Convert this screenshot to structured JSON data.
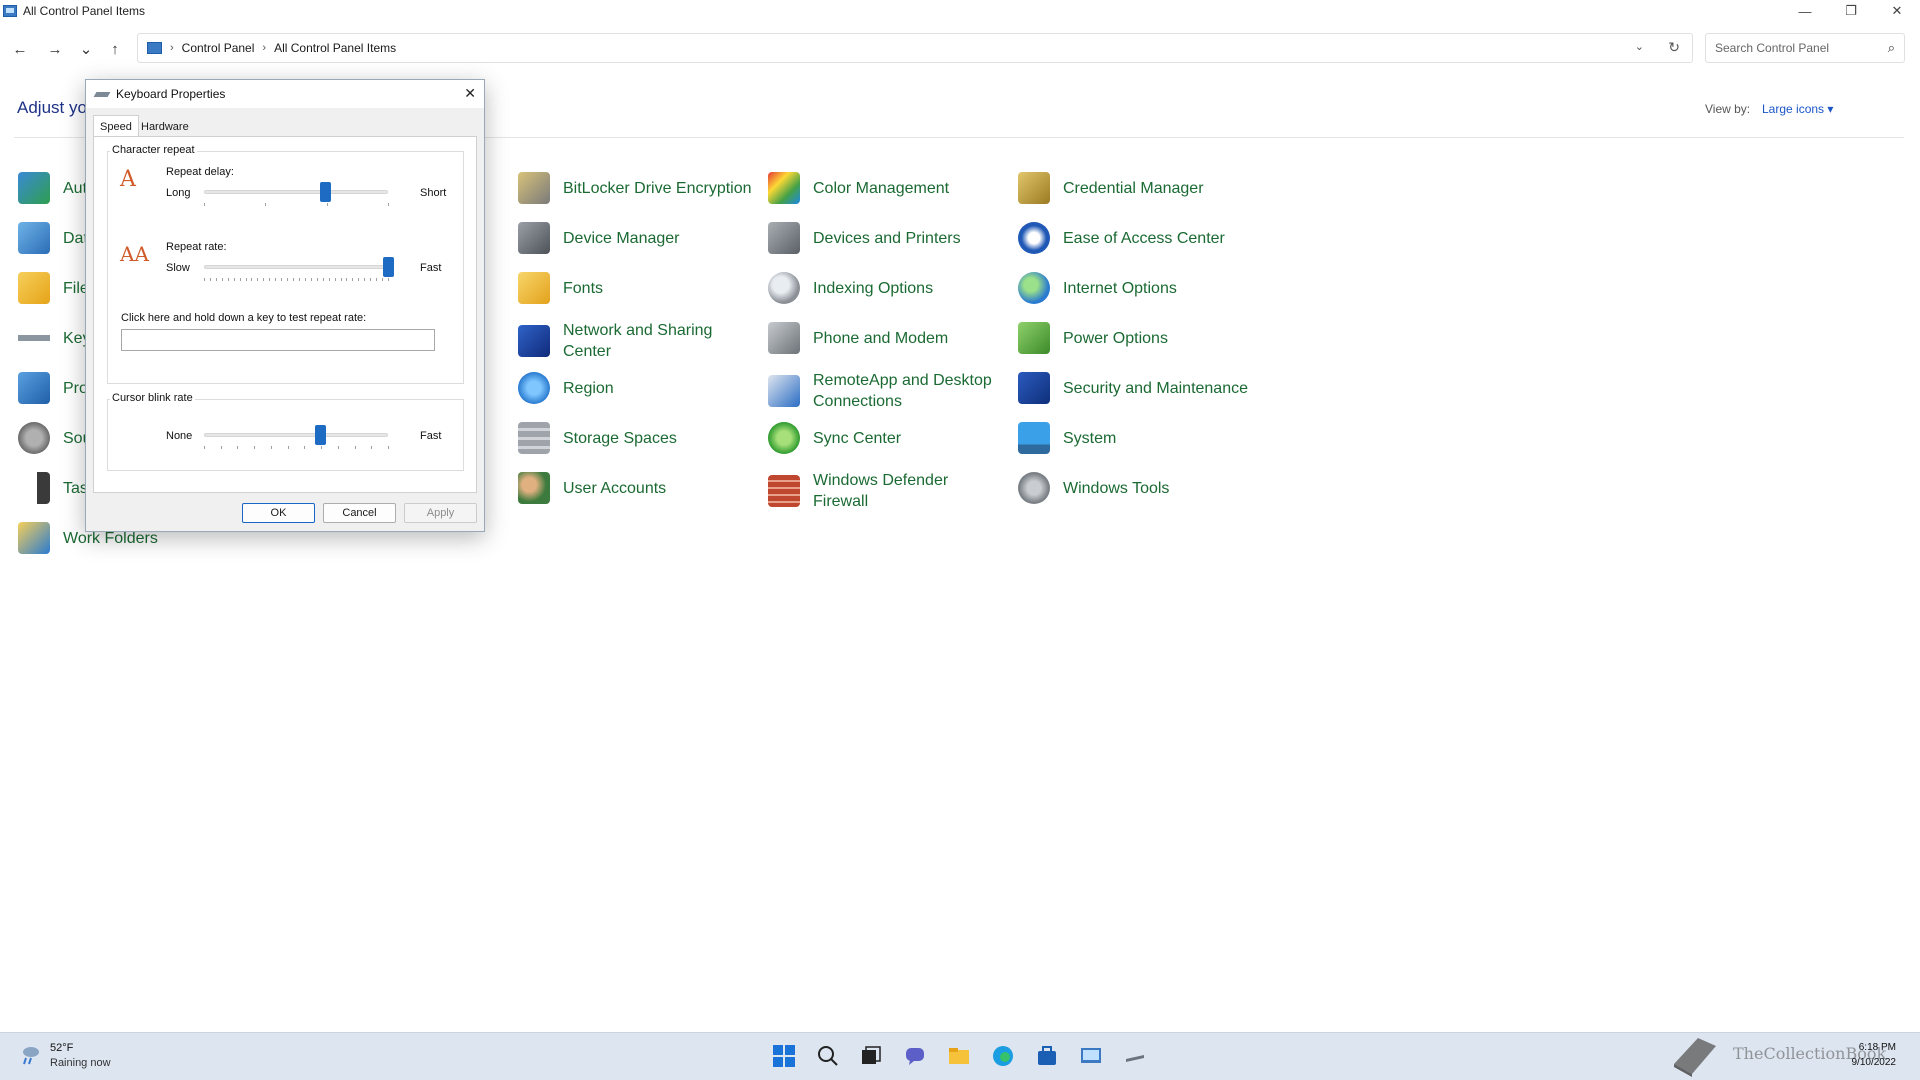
{
  "window": {
    "title": "All Control Panel Items",
    "minimize_glyph": "—",
    "restore_glyph": "❐",
    "close_glyph": "✕"
  },
  "nav": {
    "back_glyph": "←",
    "forward_glyph": "→",
    "recent_glyph": "⌄",
    "up_glyph": "↑"
  },
  "address": {
    "crumbs": [
      "Control Panel",
      "All Control Panel Items"
    ],
    "sep_glyph": "›",
    "dropdown_glyph": "⌄",
    "refresh_glyph": "↻"
  },
  "search": {
    "placeholder": "Search Control Panel",
    "glyph": "⌕"
  },
  "main": {
    "heading_visible": "Adjust yo",
    "view_by_label": "View by:",
    "view_by_value": "Large icons ▾"
  },
  "items_left": [
    {
      "label": "Aut",
      "icon": "autoplay-icon"
    },
    {
      "label": "Dat",
      "icon": "date-time-icon"
    },
    {
      "label": "File",
      "icon": "file-explorer-options-icon"
    },
    {
      "label": "Key",
      "icon": "keyboard-icon"
    },
    {
      "label": "Pro",
      "icon": "programs-icon"
    },
    {
      "label": "Sou",
      "icon": "sound-icon"
    },
    {
      "label": "Tasl",
      "icon": "taskbar-icon"
    },
    {
      "label": "Work Folders",
      "icon": "work-folders-icon"
    }
  ],
  "items_col2": [
    {
      "label": "BitLocker Drive Encryption",
      "icon": "bitlocker-icon"
    },
    {
      "label": "Device Manager",
      "icon": "device-manager-icon"
    },
    {
      "label": "Fonts",
      "icon": "fonts-icon"
    },
    {
      "label": "Network and Sharing Center",
      "icon": "network-icon"
    },
    {
      "label": "Region",
      "icon": "region-icon"
    },
    {
      "label": "Storage Spaces",
      "icon": "storage-spaces-icon"
    },
    {
      "label": "User Accounts",
      "icon": "user-accounts-icon"
    }
  ],
  "items_col3": [
    {
      "label": "Color Management",
      "icon": "color-management-icon"
    },
    {
      "label": "Devices and Printers",
      "icon": "devices-printers-icon"
    },
    {
      "label": "Indexing Options",
      "icon": "indexing-icon"
    },
    {
      "label": "Phone and Modem",
      "icon": "phone-modem-icon"
    },
    {
      "label": "RemoteApp and Desktop Connections",
      "icon": "remoteapp-icon"
    },
    {
      "label": "Sync Center",
      "icon": "sync-center-icon"
    },
    {
      "label": "Windows Defender Firewall",
      "icon": "firewall-icon"
    }
  ],
  "items_col4": [
    {
      "label": "Credential Manager",
      "icon": "credential-manager-icon"
    },
    {
      "label": "Ease of Access Center",
      "icon": "ease-of-access-icon"
    },
    {
      "label": "Internet Options",
      "icon": "internet-options-icon"
    },
    {
      "label": "Power Options",
      "icon": "power-options-icon"
    },
    {
      "label": "Security and Maintenance",
      "icon": "security-maintenance-icon"
    },
    {
      "label": "System",
      "icon": "system-icon"
    },
    {
      "label": "Windows Tools",
      "icon": "windows-tools-icon"
    }
  ],
  "dialog": {
    "title": "Keyboard Properties",
    "close_glyph": "✕",
    "tabs": [
      "Speed",
      "Hardware"
    ],
    "character_repeat": {
      "group_title": "Character repeat",
      "repeat_delay_label": "Repeat delay:",
      "delay_min_label": "Long",
      "delay_max_label": "Short",
      "delay_value_fraction": 0.66,
      "repeat_rate_label": "Repeat rate:",
      "rate_min_label": "Slow",
      "rate_max_label": "Fast",
      "rate_value_fraction": 1.0,
      "test_label": "Click here and hold down a key to test repeat rate:",
      "test_value": ""
    },
    "cursor_blink": {
      "group_title": "Cursor blink rate",
      "min_label": "None",
      "max_label": "Fast",
      "value_fraction": 0.63
    },
    "buttons": {
      "ok": "OK",
      "cancel": "Cancel",
      "apply": "Apply"
    }
  },
  "taskbar": {
    "weather_temp": "52°F",
    "weather_desc": "Raining now",
    "time": "6:18 PM",
    "date": "9/10/2022",
    "watermark": "TheCollectionBook"
  },
  "colors": {
    "link_green": "#1b6a33",
    "heading_blue": "#1e3287",
    "accent_blue": "#1e6bc4"
  }
}
